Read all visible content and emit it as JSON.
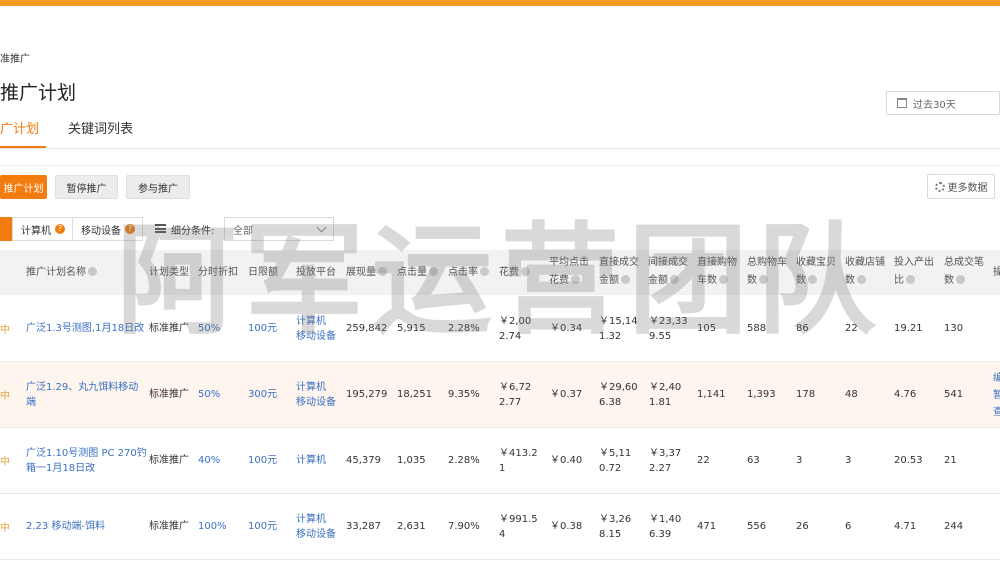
{
  "breadcrumb": "准推广",
  "page_title": "推广计划",
  "date_range": "过去30天",
  "tabs": [
    {
      "label": "广计划"
    },
    {
      "label": "关键词列表"
    }
  ],
  "actions": {
    "new_plan": "推广计划",
    "pause": "暂停推广",
    "join": "参与推广",
    "more_data": "更多数据"
  },
  "filters": {
    "computer": "计算机",
    "mobile": "移动设备",
    "detail_label": "细分条件:",
    "detail_value": "全部"
  },
  "columns": [
    {
      "line1": "推广计划名称",
      "line2": ""
    },
    {
      "line1": "计划类型",
      "line2": ""
    },
    {
      "line1": "分时折扣",
      "line2": ""
    },
    {
      "line1": "日限额",
      "line2": ""
    },
    {
      "line1": "投放平台",
      "line2": ""
    },
    {
      "line1": "展现量",
      "line2": ""
    },
    {
      "line1": "点击量",
      "line2": ""
    },
    {
      "line1": "点击率",
      "line2": ""
    },
    {
      "line1": "花费",
      "line2": ""
    },
    {
      "line1": "平均点击",
      "line2": "花费"
    },
    {
      "line1": "直接成交",
      "line2": "金额"
    },
    {
      "line1": "间接成交",
      "line2": "金额"
    },
    {
      "line1": "直接购物",
      "line2": "车数"
    },
    {
      "line1": "总购物车",
      "line2": "数"
    },
    {
      "line1": "收藏宝贝",
      "line2": "数"
    },
    {
      "line1": "收藏店铺",
      "line2": "数"
    },
    {
      "line1": "投入产出",
      "line2": "比"
    },
    {
      "line1": "总成交笔",
      "line2": "数"
    },
    {
      "line1": "操",
      "line2": ""
    }
  ],
  "rows": [
    {
      "status": "中",
      "name1": "广泛1.3号测图,1月18日改",
      "name2": "",
      "type": "标准推广",
      "discount": "50%",
      "limit": "100元",
      "platform1": "计算机",
      "platform2": "移动设备",
      "impressions": "259,842",
      "clicks": "5,915",
      "ctr": "2.28%",
      "cost1": "￥2,00",
      "cost2": "2.74",
      "cpc": "￥0.34",
      "direct1": "￥15,14",
      "direct2": "1.32",
      "indirect1": "￥23,33",
      "indirect2": "9.55",
      "direct_cart": "105",
      "total_cart": "588",
      "fav_item": "86",
      "fav_shop": "22",
      "roi": "19.21",
      "orders": "130",
      "ops": []
    },
    {
      "status": "中",
      "name1": "广泛1.29、丸九饵料移动",
      "name2": "端",
      "type": "标准推广",
      "discount": "50%",
      "limit": "300元",
      "platform1": "计算机",
      "platform2": "移动设备",
      "impressions": "195,279",
      "clicks": "18,251",
      "ctr": "9.35%",
      "cost1": "￥6,72",
      "cost2": "2.77",
      "cpc": "￥0.37",
      "direct1": "￥29,60",
      "direct2": "6.38",
      "indirect1": "￥2,40",
      "indirect2": "1.81",
      "direct_cart": "1,141",
      "total_cart": "1,393",
      "fav_item": "178",
      "fav_shop": "48",
      "roi": "4.76",
      "orders": "541",
      "ops": [
        "编",
        "暂",
        "查"
      ]
    },
    {
      "status": "中",
      "name1": "广泛1.10号测图 PC 270钓",
      "name2": "箱一1月18日改",
      "type": "标准推广",
      "discount": "40%",
      "limit": "100元",
      "platform1": "计算机",
      "platform2": "",
      "impressions": "45,379",
      "clicks": "1,035",
      "ctr": "2.28%",
      "cost1": "￥413.2",
      "cost2": "1",
      "cpc": "￥0.40",
      "direct1": "￥5,11",
      "direct2": "0.72",
      "indirect1": "￥3,37",
      "indirect2": "2.27",
      "direct_cart": "22",
      "total_cart": "63",
      "fav_item": "3",
      "fav_shop": "3",
      "roi": "20.53",
      "orders": "21",
      "ops": []
    },
    {
      "status": "中",
      "name1": "2.23 移动端-饵料",
      "name2": "",
      "type": "标准推广",
      "discount": "100%",
      "limit": "100元",
      "platform1": "计算机",
      "platform2": "移动设备",
      "impressions": "33,287",
      "clicks": "2,631",
      "ctr": "7.90%",
      "cost1": "￥991.5",
      "cost2": "4",
      "cpc": "￥0.38",
      "direct1": "￥3,26",
      "direct2": "8.15",
      "indirect1": "￥1,40",
      "indirect2": "6.39",
      "direct_cart": "471",
      "total_cart": "556",
      "fav_item": "26",
      "fav_shop": "6",
      "roi": "4.71",
      "orders": "244",
      "ops": []
    }
  ],
  "watermark": "阿军运营团队",
  "colors": {
    "accent": "#f27c0f",
    "link": "#3a6fc4",
    "top_bar": "#f59a23"
  }
}
